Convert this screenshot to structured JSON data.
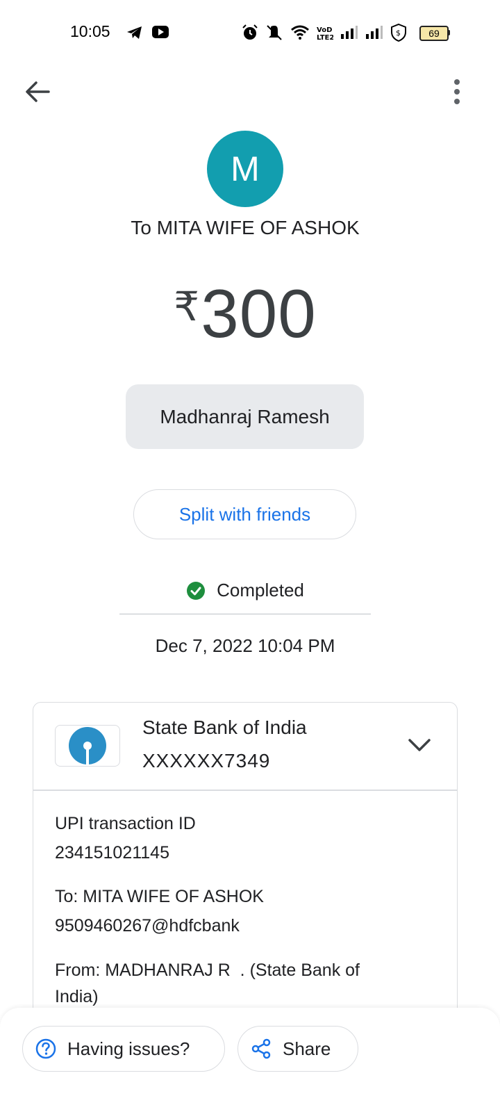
{
  "status_bar": {
    "time": "10:05",
    "battery": "69"
  },
  "payee_line": "To MITA WIFE OF ASHOK",
  "avatar_letter": "M",
  "amount": {
    "currency": "₹",
    "value": "300"
  },
  "note": "Madhanraj Ramesh",
  "split_label": "Split with friends",
  "status": "Completed",
  "datetime": "Dec 7, 2022 10:04 PM",
  "bank": {
    "name": "State Bank of India",
    "account": "XXXXXX7349"
  },
  "details": {
    "upi_label": "UPI transaction ID",
    "upi_id": "234151021145",
    "to_label": "To: MITA WIFE OF ASHOK",
    "to_vpa": "9509460267@hdfcbank",
    "from_label_1": "From: MADHANRAJ R  . (State Bank of",
    "from_label_2": "India)"
  },
  "actions": {
    "issues_label": "Having issues?",
    "share_label": "Share"
  },
  "colors": {
    "avatar": "#129eaf",
    "accent": "#1a73e8",
    "success": "#1e8e3e"
  }
}
